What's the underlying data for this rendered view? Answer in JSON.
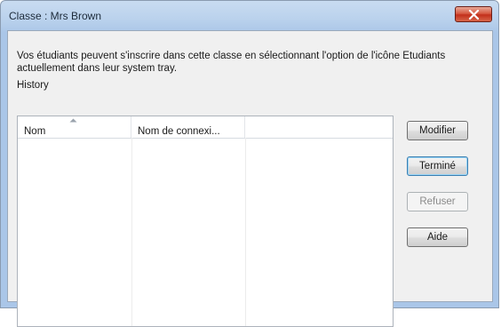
{
  "window": {
    "title": "Classe : Mrs Brown"
  },
  "content": {
    "description": "Vos étudiants peuvent s'inscrire dans cette classe en sélectionnant l'option de l'icône Etudiants actuellement dans leur system tray.",
    "history_label": "History"
  },
  "list": {
    "columns": [
      "Nom",
      "Nom de connexi..."
    ],
    "sort_column": "Nom",
    "sort_direction": "ascending",
    "rows": []
  },
  "buttons": {
    "modify": "Modifier",
    "done": "Terminé",
    "refuse": "Refuser",
    "help": "Aide"
  },
  "icons": {
    "close": "close-icon",
    "sort": "sort-ascending-icon"
  },
  "colors": {
    "close_button": "#c7341f",
    "titlebar": "#b9d1ec",
    "client_background": "#f0f0f0"
  }
}
